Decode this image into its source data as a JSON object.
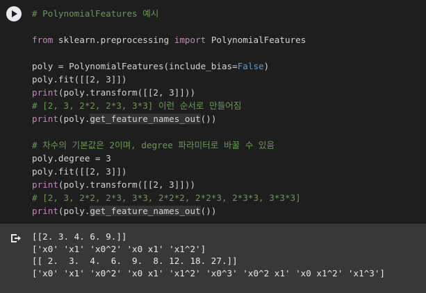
{
  "run_button": {
    "icon": "play-icon"
  },
  "code_lines": [
    {
      "parts": [
        {
          "t": "# PolynomialFeatures 예시",
          "c": "c"
        }
      ]
    },
    {
      "parts": []
    },
    {
      "parts": [
        {
          "t": "from",
          "c": "k"
        },
        {
          "t": " sklearn.preprocessing ",
          "c": "f"
        },
        {
          "t": "import",
          "c": "k"
        },
        {
          "t": " PolynomialFeatures",
          "c": "f"
        }
      ]
    },
    {
      "parts": []
    },
    {
      "parts": [
        {
          "t": "poly = PolynomialFeatures(include_bias=",
          "c": "f"
        },
        {
          "t": "False",
          "c": "b"
        },
        {
          "t": ")",
          "c": "f"
        }
      ]
    },
    {
      "parts": [
        {
          "t": "poly.fit([[2, 3]])",
          "c": "f"
        }
      ]
    },
    {
      "parts": [
        {
          "t": "print",
          "c": "k"
        },
        {
          "t": "(poly.transform([[2, 3]]))",
          "c": "f"
        }
      ]
    },
    {
      "parts": [
        {
          "t": "# [2, 3, 2*2, 2*3, 3*3] 이런 순서로 만들어짐",
          "c": "c"
        }
      ]
    },
    {
      "parts": [
        {
          "t": "print",
          "c": "k"
        },
        {
          "t": "(poly.",
          "c": "f"
        },
        {
          "t": "get_feature_names_out",
          "c": "hl"
        },
        {
          "t": "())",
          "c": "f"
        }
      ]
    },
    {
      "parts": []
    },
    {
      "parts": [
        {
          "t": "# 차수의 기본값은 2이며, degree 파라미터로 바꿀 수 있음",
          "c": "c"
        }
      ]
    },
    {
      "parts": [
        {
          "t": "poly.degree = 3",
          "c": "f"
        }
      ]
    },
    {
      "parts": [
        {
          "t": "poly.fit([[2, 3]])",
          "c": "f"
        }
      ]
    },
    {
      "parts": [
        {
          "t": "print",
          "c": "k"
        },
        {
          "t": "(poly.transform([[2, 3]]))",
          "c": "f"
        }
      ]
    },
    {
      "parts": [
        {
          "t": "# [2, 3, 2*2, 2*3, 3*3, 2*2*2, 2*2*3, 2*3*3, 3*3*3]",
          "c": "c"
        }
      ]
    },
    {
      "parts": [
        {
          "t": "print",
          "c": "k"
        },
        {
          "t": "(poly.",
          "c": "f"
        },
        {
          "t": "get_feature_names_out",
          "c": "hl"
        },
        {
          "t": "())",
          "c": "f"
        }
      ]
    }
  ],
  "output": {
    "icon": "output-redirect-icon",
    "lines": [
      "[[2. 3. 4. 6. 9.]]",
      "['x0' 'x1' 'x0^2' 'x0 x1' 'x1^2']",
      "[[ 2.  3.  4.  6.  9.  8. 12. 18. 27.]]",
      "['x0' 'x1' 'x0^2' 'x0 x1' 'x1^2' 'x0^3' 'x0^2 x1' 'x0 x1^2' 'x1^3']"
    ]
  }
}
